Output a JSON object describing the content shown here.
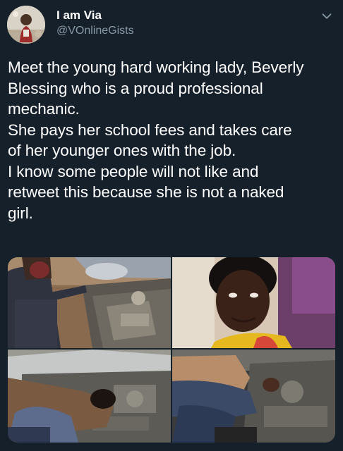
{
  "tweet": {
    "display_name": "I am Via",
    "handle": "@VOnlineGists",
    "avatar_icon": "profile-avatar",
    "menu_icon": "chevron-down-icon",
    "body_lines": [
      "Meet the young hard working lady, Beverly",
      "Blessing who is a proud professional",
      "mechanic.",
      "She pays her school fees and takes care",
      "of her younger ones with the job.",
      "I know some people will not like and",
      "retweet this because she is not a naked",
      "girl."
    ],
    "media_count": 4
  },
  "colors": {
    "background": "#15202b",
    "text_primary": "#ffffff",
    "text_secondary": "#8899a6"
  }
}
